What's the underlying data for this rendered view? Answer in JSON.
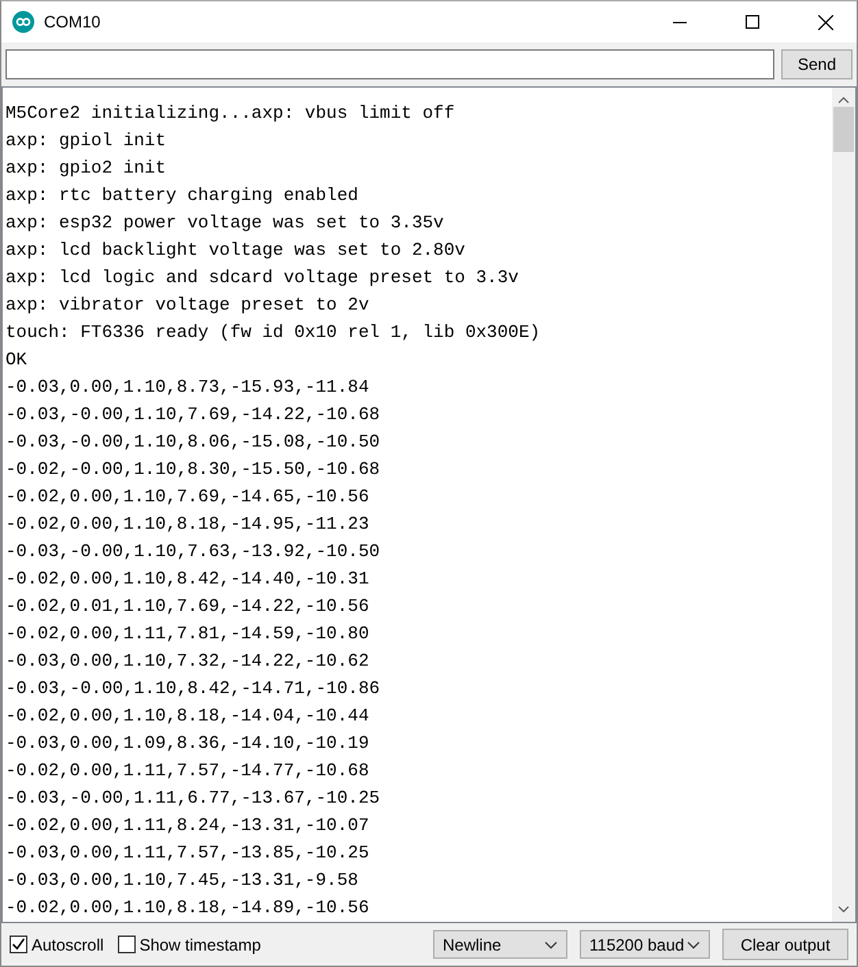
{
  "window": {
    "title": "COM10"
  },
  "send_button": "Send",
  "output_lines": [
    "M5Core2 initializing...axp: vbus limit off",
    "axp: gpiol init",
    "axp: gpio2 init",
    "axp: rtc battery charging enabled",
    "axp: esp32 power voltage was set to 3.35v",
    "axp: lcd backlight voltage was set to 2.80v",
    "axp: lcd logic and sdcard voltage preset to 3.3v",
    "axp: vibrator voltage preset to 2v",
    "touch: FT6336 ready (fw id 0x10 rel 1, lib 0x300E)",
    "OK",
    "-0.03,0.00,1.10,8.73,-15.93,-11.84",
    "-0.03,-0.00,1.10,7.69,-14.22,-10.68",
    "-0.03,-0.00,1.10,8.06,-15.08,-10.50",
    "-0.02,-0.00,1.10,8.30,-15.50,-10.68",
    "-0.02,0.00,1.10,7.69,-14.65,-10.56",
    "-0.02,0.00,1.10,8.18,-14.95,-11.23",
    "-0.03,-0.00,1.10,7.63,-13.92,-10.50",
    "-0.02,0.00,1.10,8.42,-14.40,-10.31",
    "-0.02,0.01,1.10,7.69,-14.22,-10.56",
    "-0.02,0.00,1.11,7.81,-14.59,-10.80",
    "-0.03,0.00,1.10,7.32,-14.22,-10.62",
    "-0.03,-0.00,1.10,8.42,-14.71,-10.86",
    "-0.02,0.00,1.10,8.18,-14.04,-10.44",
    "-0.03,0.00,1.09,8.36,-14.10,-10.19",
    "-0.02,0.00,1.11,7.57,-14.77,-10.68",
    "-0.03,-0.00,1.11,6.77,-13.67,-10.25",
    "-0.02,0.00,1.11,8.24,-13.31,-10.07",
    "-0.03,0.00,1.11,7.57,-13.85,-10.25",
    "-0.03,0.00,1.10,7.45,-13.31,-9.58",
    "-0.02,0.00,1.10,8.18,-14.89,-10.56"
  ],
  "footer": {
    "autoscroll": {
      "label": "Autoscroll",
      "checked": true
    },
    "show_timestamp": {
      "label": "Show timestamp",
      "checked": false
    },
    "line_ending": "Newline",
    "baud": "115200 baud",
    "clear_button": "Clear output"
  }
}
